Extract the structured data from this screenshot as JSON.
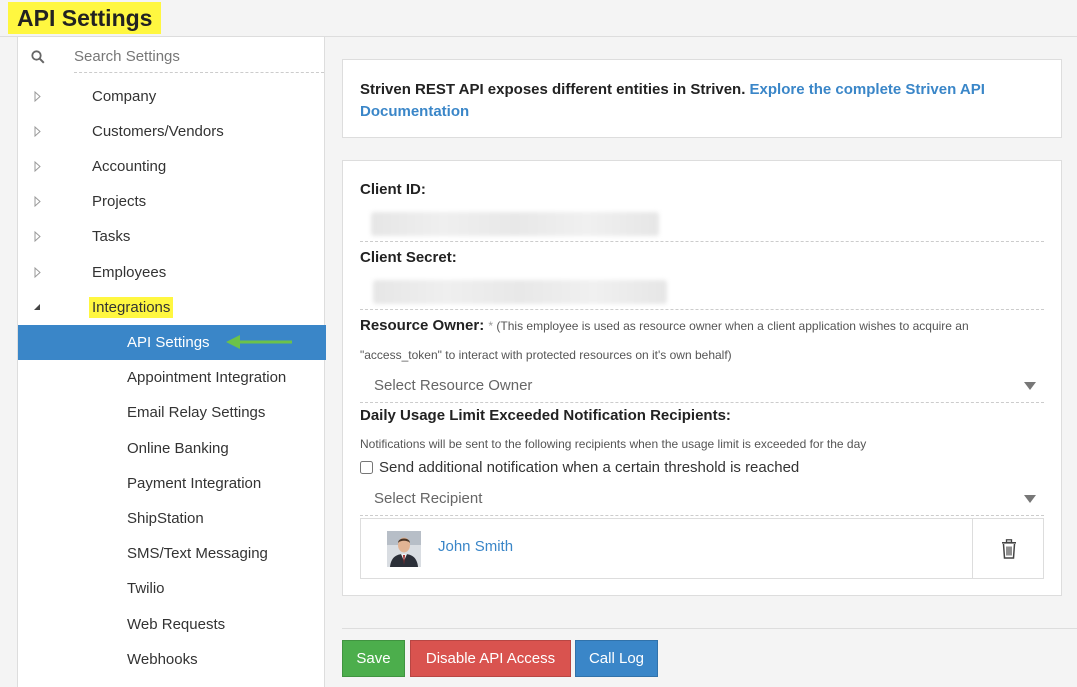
{
  "page": {
    "title": "API Settings"
  },
  "sidebar": {
    "search_placeholder": "Search Settings",
    "items": [
      {
        "label": "Company"
      },
      {
        "label": "Customers/Vendors"
      },
      {
        "label": "Accounting"
      },
      {
        "label": "Projects"
      },
      {
        "label": "Tasks"
      },
      {
        "label": "Employees"
      },
      {
        "label": "Integrations"
      }
    ],
    "sub_items": [
      {
        "label": "API Settings"
      },
      {
        "label": "Appointment Integration"
      },
      {
        "label": "Email Relay Settings"
      },
      {
        "label": "Online Banking"
      },
      {
        "label": "Payment Integration"
      },
      {
        "label": "ShipStation"
      },
      {
        "label": "SMS/Text Messaging"
      },
      {
        "label": "Twilio"
      },
      {
        "label": "Web Requests"
      },
      {
        "label": "Webhooks"
      }
    ]
  },
  "info": {
    "text": "Striven REST API exposes different entities in Striven. ",
    "link": "Explore the complete Striven API Documentation"
  },
  "form": {
    "client_id_label": "Client ID:",
    "client_secret_label": "Client Secret:",
    "resource_owner_label": "Resource Owner:",
    "resource_owner_required": "*",
    "resource_owner_hint_1": " (This employee is used as resource owner when a client application wishes to acquire an",
    "resource_owner_hint_2": "\"access_token\" to interact with protected resources on it's own behalf)",
    "resource_owner_placeholder": "Select Resource Owner",
    "usage_label": "Daily Usage Limit Exceeded Notification Recipients:",
    "usage_hint": "Notifications will be sent to the following recipients when the usage limit is exceeded for the day",
    "threshold_checkbox_label": "Send additional notification when a certain threshold is reached",
    "recipient_placeholder": "Select Recipient",
    "recipients": [
      {
        "name": "John Smith"
      }
    ]
  },
  "buttons": {
    "save": "Save",
    "disable": "Disable API Access",
    "call_log": "Call Log"
  },
  "colors": {
    "highlight": "#fff740",
    "active_nav": "#3a86c8",
    "save_button": "#4cae4c",
    "disable_button": "#d9534f",
    "link": "#3a86c8",
    "annotation_arrow": "#6cc24a"
  }
}
